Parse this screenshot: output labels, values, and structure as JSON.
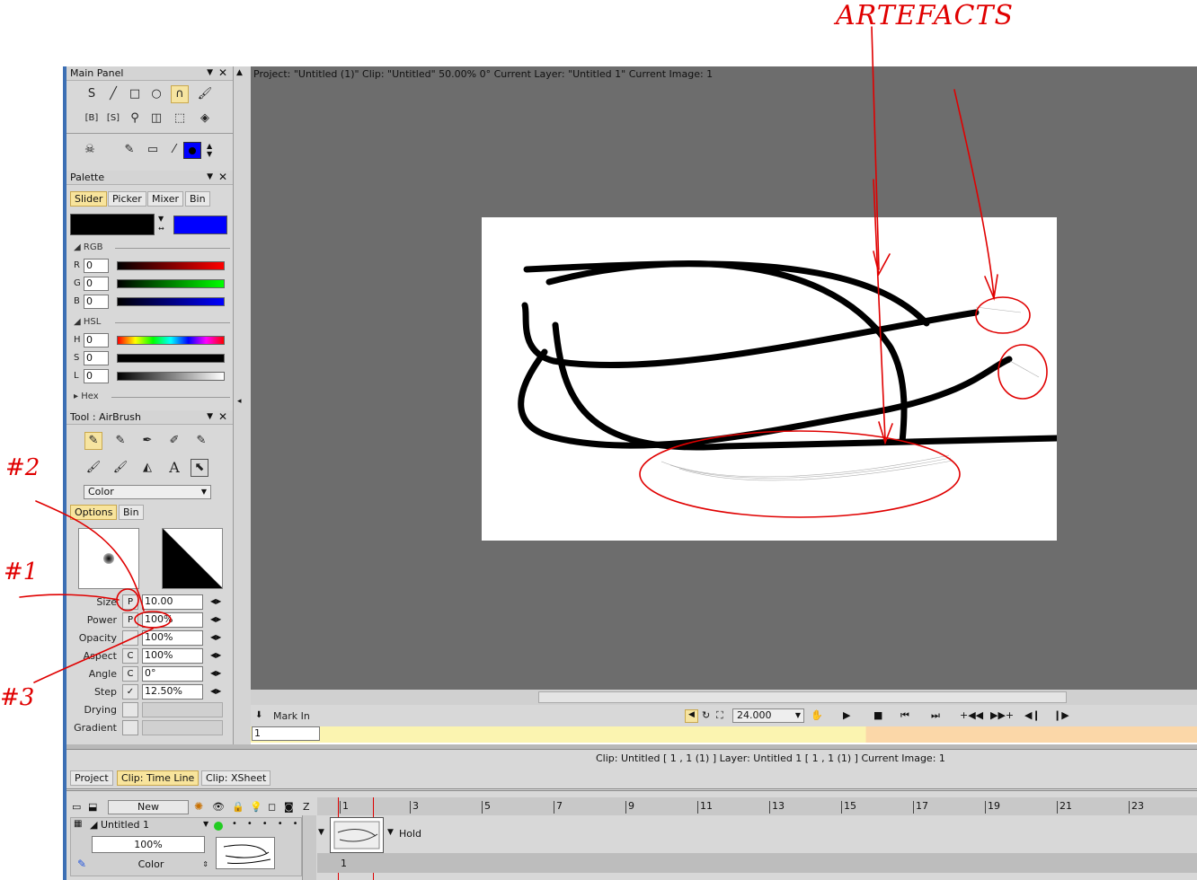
{
  "annotations": {
    "artefacts_label": "ARTEFACTS",
    "mark1": "#1",
    "mark2": "#2",
    "mark3": "#3"
  },
  "main_panel": {
    "title": "Main Panel"
  },
  "palette": {
    "title": "Palette",
    "tabs": [
      "Slider",
      "Picker",
      "Mixer",
      "Bin"
    ],
    "rgb_label": "RGB",
    "hsl_label": "HSL",
    "hex_label": "Hex",
    "channels": [
      {
        "name": "R",
        "value": "0"
      },
      {
        "name": "G",
        "value": "0"
      },
      {
        "name": "B",
        "value": "0"
      },
      {
        "name": "H",
        "value": "0"
      },
      {
        "name": "S",
        "value": "0"
      },
      {
        "name": "L",
        "value": "0"
      }
    ],
    "primary_color": "#000000",
    "secondary_color": "#0000ff"
  },
  "tool_panel": {
    "title": "Tool : AirBrush",
    "mode": "Color",
    "tabs": [
      "Options",
      "Bin"
    ],
    "options": [
      {
        "label": "Size",
        "flag": "P",
        "value": "10.00"
      },
      {
        "label": "Power",
        "flag": "P",
        "value": "100%"
      },
      {
        "label": "Opacity",
        "flag": "",
        "value": "100%"
      },
      {
        "label": "Aspect",
        "flag": "C",
        "value": "100%"
      },
      {
        "label": "Angle",
        "flag": "C",
        "value": "0°"
      },
      {
        "label": "Step",
        "flag": "✓",
        "value": "12.50%"
      },
      {
        "label": "Drying",
        "flag": "",
        "value": ""
      },
      {
        "label": "Gradient",
        "flag": "",
        "value": ""
      }
    ]
  },
  "canvas": {
    "header": "Project:  \"Untitled (1)\"  Clip: \"Untitled\"   50.00%   0°   Current Layer: \"Untitled 1\"   Current Image: 1"
  },
  "transport": {
    "mark_in": "Mark In",
    "frame_rate": "24.000",
    "frame_field": "1"
  },
  "timeline": {
    "info": "Clip: Untitled [ 1 , 1  (1) ]      Layer: Untitled 1 [ 1 , 1  (1) ]   Current Image: 1",
    "tabs": [
      "Project",
      "Clip: Time Line",
      "Clip: XSheet"
    ],
    "new_button": "New",
    "z_label": "Z",
    "ruler": [
      "1",
      "3",
      "5",
      "7",
      "9",
      "11",
      "13",
      "15",
      "17",
      "19",
      "21",
      "23"
    ],
    "layer_name": "Untitled 1",
    "layer_opacity": "100%",
    "layer_mode": "Color",
    "hold_label": "Hold",
    "frame_number": "1"
  }
}
